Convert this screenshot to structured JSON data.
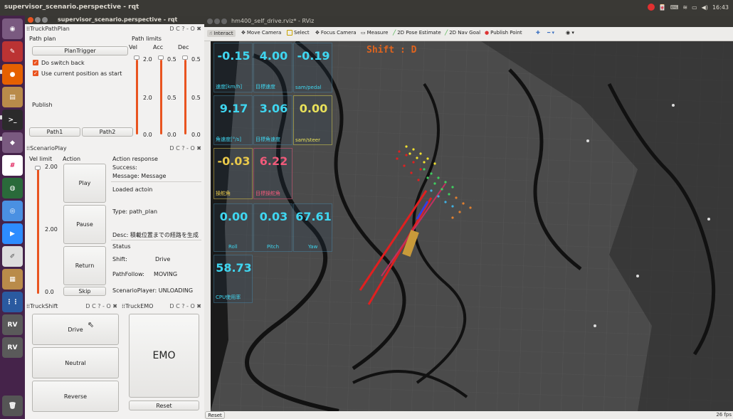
{
  "topbar": {
    "title": "supervisor_scenario.perspective - rqt",
    "time": "16:43"
  },
  "rqt_window": {
    "title": "supervisor_scenario.perspective - rqt"
  },
  "panel_controls": "D C ? - O ✖",
  "truck_path_plan": {
    "header": "TruckPathPlan",
    "path_plan_label": "Path plan",
    "path_limits_label": "Path limits",
    "plan_trigger": "PlanTrigger",
    "do_switch_back": "Do switch back",
    "use_current_position": "Use current position as start",
    "publish_label": "Publish",
    "path1": "Path1",
    "path2": "Path2",
    "sliders": [
      {
        "label": "Vel",
        "top": "2.0",
        "mid": "2.0",
        "bottom": "0.0"
      },
      {
        "label": "Acc",
        "top": "0.5",
        "mid": "0.5",
        "bottom": "0.0"
      },
      {
        "label": "Dec",
        "top": "0.5",
        "mid": "0.5",
        "bottom": "0.0"
      }
    ]
  },
  "scenario_play": {
    "header": "ScenarioPlay",
    "vel_limit_label": "Vel limit",
    "action_label": "Action",
    "action_response_label": "Action response",
    "vel_top": "2.00",
    "vel_mid": "2.00",
    "vel_bottom": "0.0",
    "success": "Success:",
    "message": "Message: Message",
    "loaded_action": "Loaded actoin",
    "type": "Type: path_plan",
    "desc": "Desc: 積載位置までの経路を生成",
    "status_label": "Status",
    "shift_label": "Shift:",
    "shift_value": "Drive",
    "path_follow_label": "PathFollow:",
    "path_follow_value": "MOVING",
    "scenario_player": "ScenarioPlayer: UNLOADING",
    "play": "Play",
    "pause": "Pause",
    "return": "Return",
    "skip": "Skip"
  },
  "truck_shift": {
    "header": "TruckShift",
    "drive": "Drive",
    "neutral": "Neutral",
    "reverse": "Reverse"
  },
  "truck_emo": {
    "header": "TruckEMO",
    "emo": "EMO",
    "reset": "Reset"
  },
  "rviz": {
    "title": "hm400_self_drive.rviz* - RViz",
    "toolbar": [
      "Interact",
      "Move Camera",
      "Select",
      "Focus Camera",
      "Measure",
      "2D Pose Estimate",
      "2D Nav Goal",
      "Publish Point"
    ],
    "status_reset": "Reset",
    "fps": "26 fps",
    "shift_overlay": "Shift : D",
    "hud": [
      {
        "value": "-0.15",
        "label": "速度[km/h]",
        "color": "#3fd6f0"
      },
      {
        "value": "4.00",
        "label": "目標速度",
        "color": "#3fd6f0"
      },
      {
        "value": "-0.19",
        "label": "sam/pedal",
        "color": "#3fd6f0"
      },
      {
        "value": "9.17",
        "label": "角速度[°/s]",
        "color": "#3fd6f0"
      },
      {
        "value": "3.06",
        "label": "目標角速度",
        "color": "#3fd6f0"
      },
      {
        "value": "0.00",
        "label": "sam/steer",
        "color": "#e8e05a"
      },
      {
        "value": "-0.03",
        "label": "操舵角",
        "color": "#e8c84a"
      },
      {
        "value": "6.22",
        "label": "目標操舵角",
        "color": "#f05a7a"
      },
      {
        "value": "0.00",
        "label": "Roll",
        "color": "#3fd6f0"
      },
      {
        "value": "0.03",
        "label": "Pitch",
        "color": "#3fd6f0"
      },
      {
        "value": "67.61",
        "label": "Yaw",
        "color": "#3fd6f0"
      },
      {
        "value": "58.73",
        "label": "CPU使用率",
        "color": "#3fd6f0"
      }
    ]
  },
  "colors": {
    "accent": "#e95420",
    "launcher": "#45234a",
    "hud": "#3fd6f0"
  }
}
